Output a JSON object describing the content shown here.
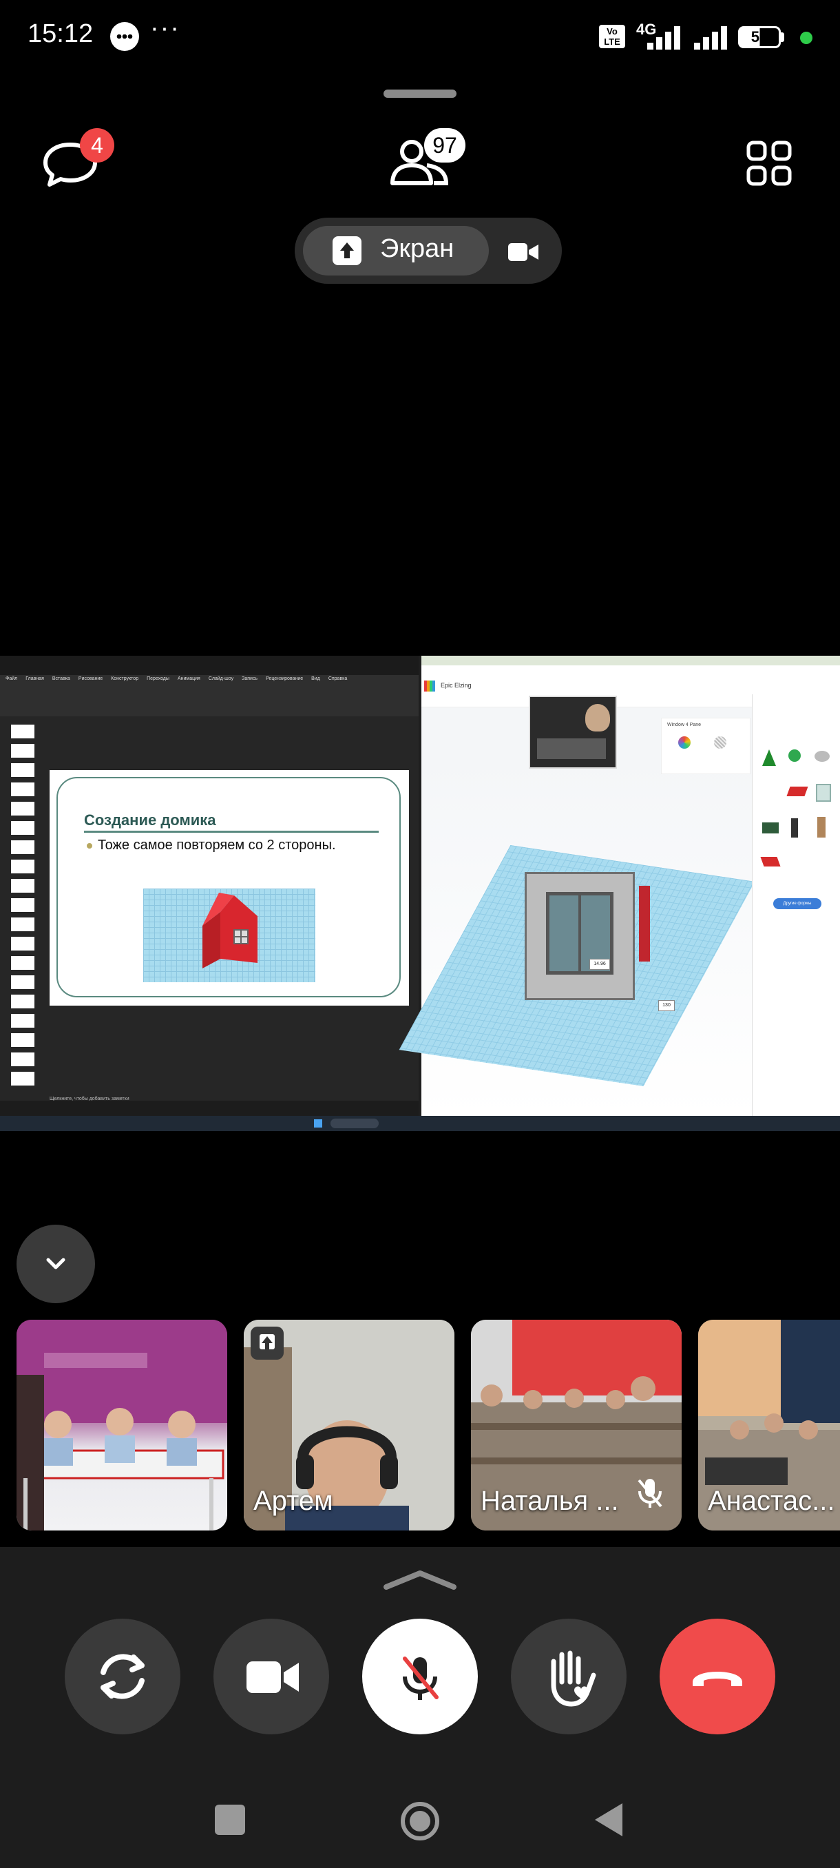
{
  "status": {
    "time": "15:12",
    "dots": "···",
    "volte_line1": "Vo",
    "volte_line2": "LTE",
    "network": "4G",
    "battery": "51"
  },
  "call_header": {
    "chat_unread": "4",
    "participants_count": "97",
    "screen_label": "Экран"
  },
  "shared_screen": {
    "slide_title": "Создание домика",
    "slide_bullet": "Тоже самое повторяем со 2 стороны.",
    "ppt_tabs": [
      "Файл",
      "Главная",
      "Вставка",
      "Рисование",
      "Конструктор",
      "Переходы",
      "Анимация",
      "Слайд-шоу",
      "Запись",
      "Рецензирование",
      "Вид",
      "Справка"
    ],
    "ppt_notes": "Щелкните, чтобы добавить заметки",
    "tinkercad_design": "Epic Elzing",
    "tinkercad_shape": "Window 4 Pane",
    "tinkercad_button": "Другие формы",
    "dimension_a": "14.96",
    "dimension_b": "130"
  },
  "participants": [
    {
      "name": ""
    },
    {
      "name": "Артем"
    },
    {
      "name": "Наталья ..."
    },
    {
      "name": "Анастас..."
    }
  ],
  "colors": {
    "badge_red": "#f04646",
    "end_call_red": "#f04b4b",
    "control_gray": "#3a3a3a",
    "online_green": "#2ecc4a"
  }
}
